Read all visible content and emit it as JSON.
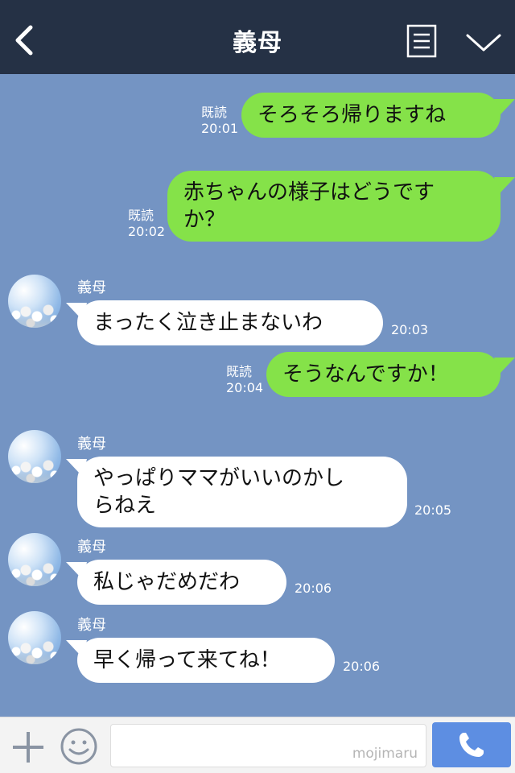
{
  "header": {
    "title": "義母",
    "back_icon": "chevron-left-icon",
    "menu_icon": "notes-icon",
    "expand_icon": "chevron-down-icon"
  },
  "messages": [
    {
      "side": "sent",
      "text_lines": [
        "そろそろ帰りますね"
      ],
      "read": "既読",
      "time": "20:01"
    },
    {
      "side": "sent",
      "text_lines": [
        "赤ちゃんの様子はどうです",
        "か？"
      ],
      "read": "既読",
      "time": "20:02"
    },
    {
      "side": "received",
      "sender": "義母",
      "text_lines": [
        "まったく泣き止まないわ"
      ],
      "time": "20:03"
    },
    {
      "side": "sent",
      "text_lines": [
        "そうなんですか！"
      ],
      "read": "既読",
      "time": "20:04"
    },
    {
      "side": "received",
      "sender": "義母",
      "text_lines": [
        "やっぱりママがいいのかし",
        "らねえ"
      ],
      "time": "20:05"
    },
    {
      "side": "received",
      "sender": "義母",
      "text_lines": [
        "私じゃだめだわ"
      ],
      "time": "20:06"
    },
    {
      "side": "received",
      "sender": "義母",
      "text_lines": [
        "早く帰って来てね！"
      ],
      "time": "20:06"
    }
  ],
  "input_bar": {
    "watermark": "mojimaru",
    "plus_icon": "plus-icon",
    "emoji_icon": "smile-icon",
    "call_icon": "phone-icon"
  },
  "colors": {
    "header_bg": "#253145",
    "chat_bg": "#7494c3",
    "sent_bubble": "#85e249",
    "received_bubble": "#ffffff",
    "call_button": "#5d8ee2"
  }
}
